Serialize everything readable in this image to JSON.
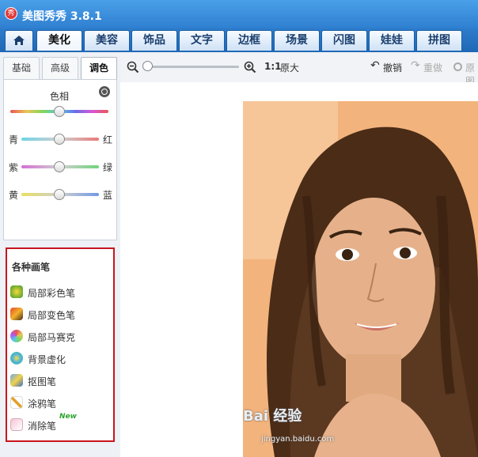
{
  "app": {
    "title": "美图秀秀 3.8.1",
    "logo_text": "秀"
  },
  "tabs": [
    {
      "label": "美化",
      "active": true
    },
    {
      "label": "美容"
    },
    {
      "label": "饰品"
    },
    {
      "label": "文字"
    },
    {
      "label": "边框"
    },
    {
      "label": "场景"
    },
    {
      "label": "闪图"
    },
    {
      "label": "娃娃"
    },
    {
      "label": "拼图"
    }
  ],
  "subtabs": [
    "基础",
    "高级",
    "调色"
  ],
  "adjust": {
    "hue_label": "色相",
    "rows": [
      {
        "left": "青",
        "right": "红"
      },
      {
        "left": "紫",
        "right": "绿"
      },
      {
        "left": "黄",
        "right": "蓝"
      }
    ]
  },
  "brushes": {
    "heading": "各种画笔",
    "items": [
      {
        "label": "局部彩色笔",
        "icon": "color-brush-icon"
      },
      {
        "label": "局部变色笔",
        "icon": "recolor-brush-icon"
      },
      {
        "label": "局部马赛克",
        "icon": "mosaic-brush-icon"
      },
      {
        "label": "背景虚化",
        "icon": "blur-brush-icon"
      },
      {
        "label": "抠图笔",
        "icon": "cutout-brush-icon"
      },
      {
        "label": "涂鸦笔",
        "icon": "doodle-brush-icon"
      },
      {
        "label": "消除笔",
        "icon": "eraser-brush-icon"
      }
    ],
    "new_badge": "New"
  },
  "toolbar": {
    "one_to_one": "1:1",
    "original_size": "原大",
    "undo": "撤销",
    "redo": "重做",
    "original": "原图"
  },
  "watermark": {
    "brand": "Bai 经验",
    "url": "jingyan.baidu.com"
  },
  "colors": {
    "accent": "#2f7fd0",
    "highlight_border": "#c8161d",
    "new_badge": "#2fa52f"
  }
}
